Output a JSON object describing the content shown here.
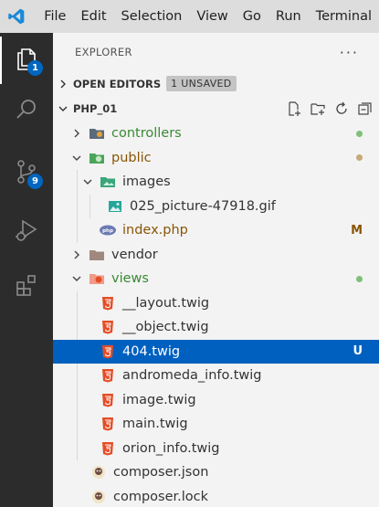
{
  "menu": [
    "File",
    "Edit",
    "Selection",
    "View",
    "Go",
    "Run",
    "Terminal"
  ],
  "activity": {
    "explorer_badge": "1",
    "scm_badge": "9"
  },
  "explorer": {
    "title": "EXPLORER",
    "more": "···",
    "open_editors": {
      "label": "OPEN EDITORS",
      "badge": "1 UNSAVED"
    },
    "project": {
      "name": "PHP_01"
    },
    "tree": [
      {
        "label": "controllers",
        "status": ""
      },
      {
        "label": "public",
        "status": ""
      },
      {
        "label": "images",
        "status": ""
      },
      {
        "label": "025_picture-47918.gif",
        "status": ""
      },
      {
        "label": "index.php",
        "status": "M"
      },
      {
        "label": "vendor",
        "status": ""
      },
      {
        "label": "views",
        "status": ""
      },
      {
        "label": "__layout.twig",
        "status": ""
      },
      {
        "label": "__object.twig",
        "status": ""
      },
      {
        "label": "404.twig",
        "status": "U"
      },
      {
        "label": "andromeda_info.twig",
        "status": ""
      },
      {
        "label": "image.twig",
        "status": ""
      },
      {
        "label": "main.twig",
        "status": ""
      },
      {
        "label": "orion_info.twig",
        "status": ""
      },
      {
        "label": "composer.json",
        "status": ""
      },
      {
        "label": "composer.lock",
        "status": ""
      }
    ]
  },
  "colors": {
    "accent": "#0060c0",
    "badge": "#0066c0",
    "untracked_green": "#388a34",
    "modified_gold": "#895503",
    "html_icon": "#e44d26"
  }
}
